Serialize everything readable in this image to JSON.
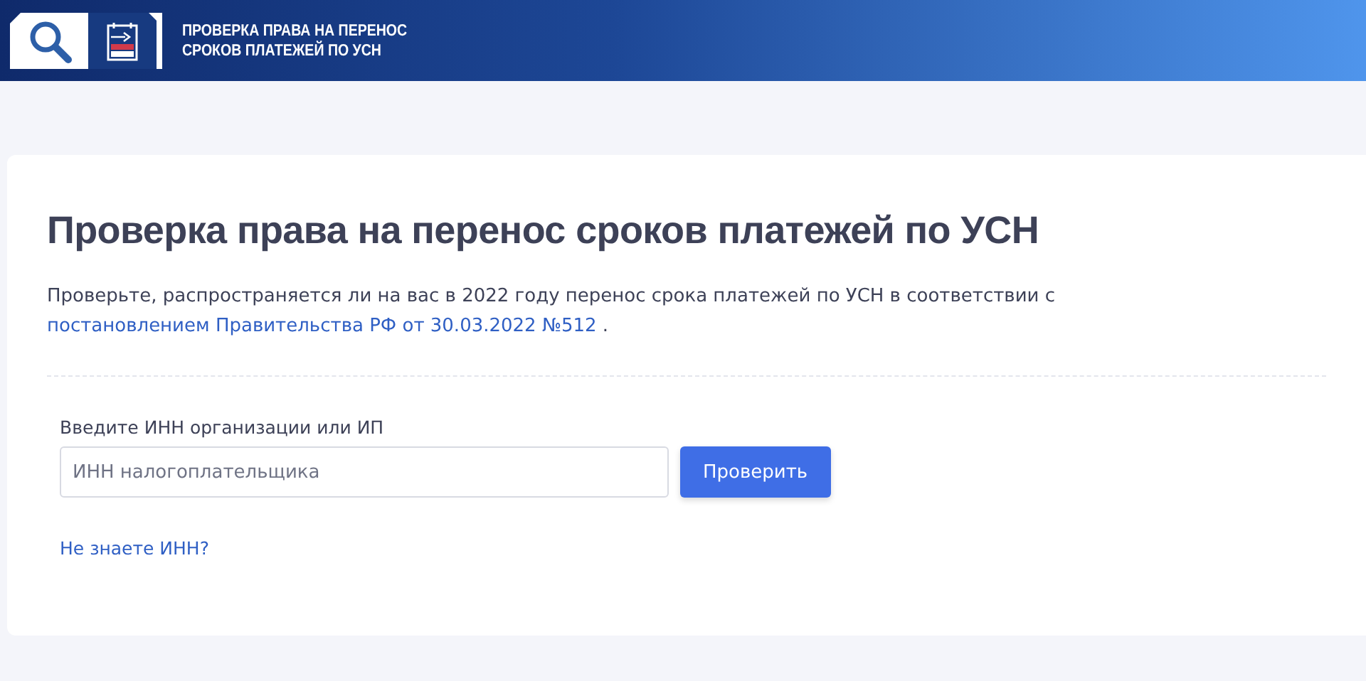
{
  "header": {
    "title_lines": [
      "ПРОВЕРКА ПРАВА НА ПЕРЕНОС",
      "СРОКОВ ПЛАТЕЖЕЙ ПО УСН"
    ]
  },
  "page": {
    "title": "Проверка права на перенос сроков платежей по УСН",
    "description": {
      "text": "Проверьте, распространяется ли на вас в 2022 году перенос срока платежей по УСН в соответствии с ",
      "link": "постановлением Правительства РФ от 30.03.2022 №512",
      "suffix": " ."
    }
  },
  "form": {
    "label": "Введите ИНН организации или ИП",
    "placeholder": "ИНН налогоплательщика",
    "button": "Проверить",
    "help_link": "Не знаете ИНН?"
  }
}
